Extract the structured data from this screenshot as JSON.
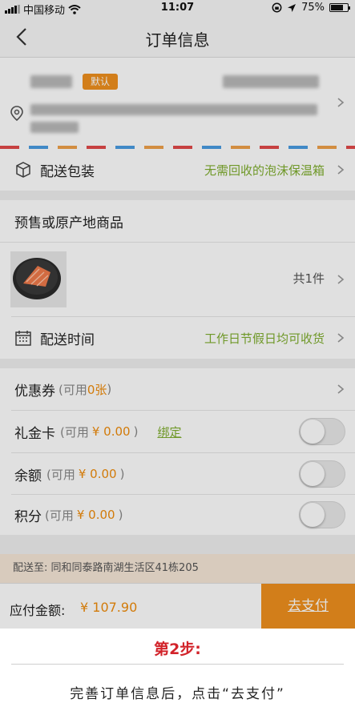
{
  "status_bar": {
    "carrier": "中国移动",
    "time": "11:07",
    "battery": "75%",
    "battery_level": 0.75
  },
  "nav": {
    "title": "订单信息"
  },
  "address": {
    "default_tag": "默认"
  },
  "packaging": {
    "label": "配送包装",
    "value": "无需回收的泡沫保温箱"
  },
  "presale": {
    "title": "预售或原产地商品",
    "count": "共1件"
  },
  "delivery_time": {
    "label": "配送时间",
    "value": "工作日节假日均可收货"
  },
  "coupon": {
    "label": "优惠券",
    "avail_prefix": "(可用",
    "avail_value": "0张",
    "avail_suffix": ")"
  },
  "gift_card": {
    "label": "礼金卡",
    "avail_prefix": "(可用",
    "avail_value": "¥ 0.00",
    "avail_suffix": ")",
    "bind": "绑定",
    "enabled": false
  },
  "balance": {
    "label": "余额",
    "avail_prefix": "(可用",
    "avail_value": "¥ 0.00",
    "avail_suffix": ")",
    "enabled": false
  },
  "points": {
    "label": "积分",
    "avail_prefix": "(可用",
    "avail_value": "¥ 0.00",
    "avail_suffix": ")",
    "enabled": false
  },
  "ship_to": "配送至: 同和同泰路南湖生活区41栋205",
  "payment": {
    "label": "应付金额:",
    "amount": "¥ 107.90",
    "button": "去支付"
  },
  "caption": {
    "step": "第2步:",
    "text": "完善订单信息后，点击“去支付”"
  },
  "colors": {
    "accent": "#f0901e",
    "green": "#7fae2e",
    "step_red": "#d2232a"
  }
}
